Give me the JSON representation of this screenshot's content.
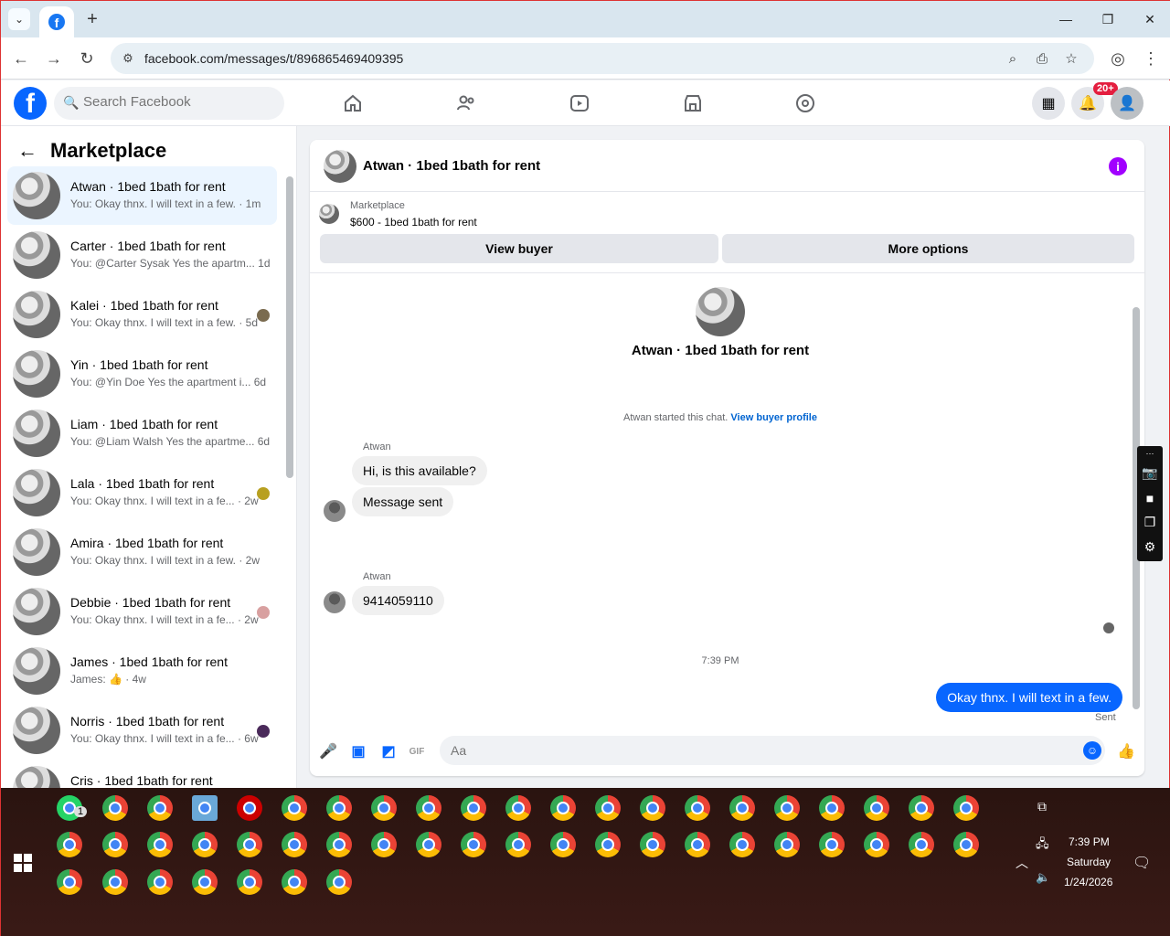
{
  "browser": {
    "tab_menu_icon": "chevron-down-icon",
    "new_tab": "+",
    "url": "facebook.com/messages/t/896865469409395"
  },
  "fb": {
    "search_placeholder": "Search Facebook",
    "notification_badge": "20+"
  },
  "left_panel": {
    "title": "Marketplace",
    "conversations": [
      {
        "name": "Atwan · 1bed 1bath for rent",
        "snippet": "You: Okay thnx. I will text in a few. · 1m",
        "active": true
      },
      {
        "name": "Carter · 1bed 1bath for rent",
        "snippet": "You: @Carter Sysak Yes the apartm...   1d"
      },
      {
        "name": "Kalei · 1bed 1bath for rent",
        "snippet": "You: Okay thnx. I will text in a few. · 5d"
      },
      {
        "name": "Yin · 1bed 1bath for rent",
        "snippet": "You: @Yin Doe Yes the apartment i...   6d"
      },
      {
        "name": "Liam · 1bed 1bath for rent",
        "snippet": "You: @Liam Walsh Yes the apartme...   6d"
      },
      {
        "name": "Lala · 1bed 1bath for rent",
        "snippet": "You: Okay thnx. I will text in a fe... · 2w"
      },
      {
        "name": "Amira · 1bed 1bath for rent",
        "snippet": "You: Okay thnx. I will text in a few. · 2w"
      },
      {
        "name": "Debbie · 1bed 1bath for rent",
        "snippet": "You: Okay thnx. I will text in a fe... · 2w"
      },
      {
        "name": "James · 1bed 1bath for rent",
        "snippet": "James: 👍 · 4w"
      },
      {
        "name": "Norris · 1bed 1bath for rent",
        "snippet": "You: Okay thnx. I will text in a fe... · 6w"
      },
      {
        "name": "Cris · 1bed 1bath for rent",
        "snippet": ""
      }
    ]
  },
  "chat": {
    "title": "Atwan · 1bed 1bath for rent",
    "marketplace_label": "Marketplace",
    "listing": "$600 - 1bed 1bath for rent",
    "view_buyer": "View buyer",
    "more_options": "More options",
    "intro_name": "Atwan · 1bed 1bath for rent",
    "started_text": "Atwan started this chat.",
    "view_buyer_profile": "View buyer profile",
    "sender1": "Atwan",
    "msg1": "Hi, is this available?",
    "msg2": "Message sent",
    "sender2": "Atwan",
    "msg3": "9414059110",
    "timestamp": "7:39 PM",
    "my_msg": "Okay thnx. I will text in a few.",
    "sent_label": "Sent",
    "input_placeholder": "Aa"
  },
  "taskbar": {
    "whatsapp_badge": "1",
    "time": "7:39 PM",
    "day": "Saturday",
    "date": "1/24/2026"
  }
}
